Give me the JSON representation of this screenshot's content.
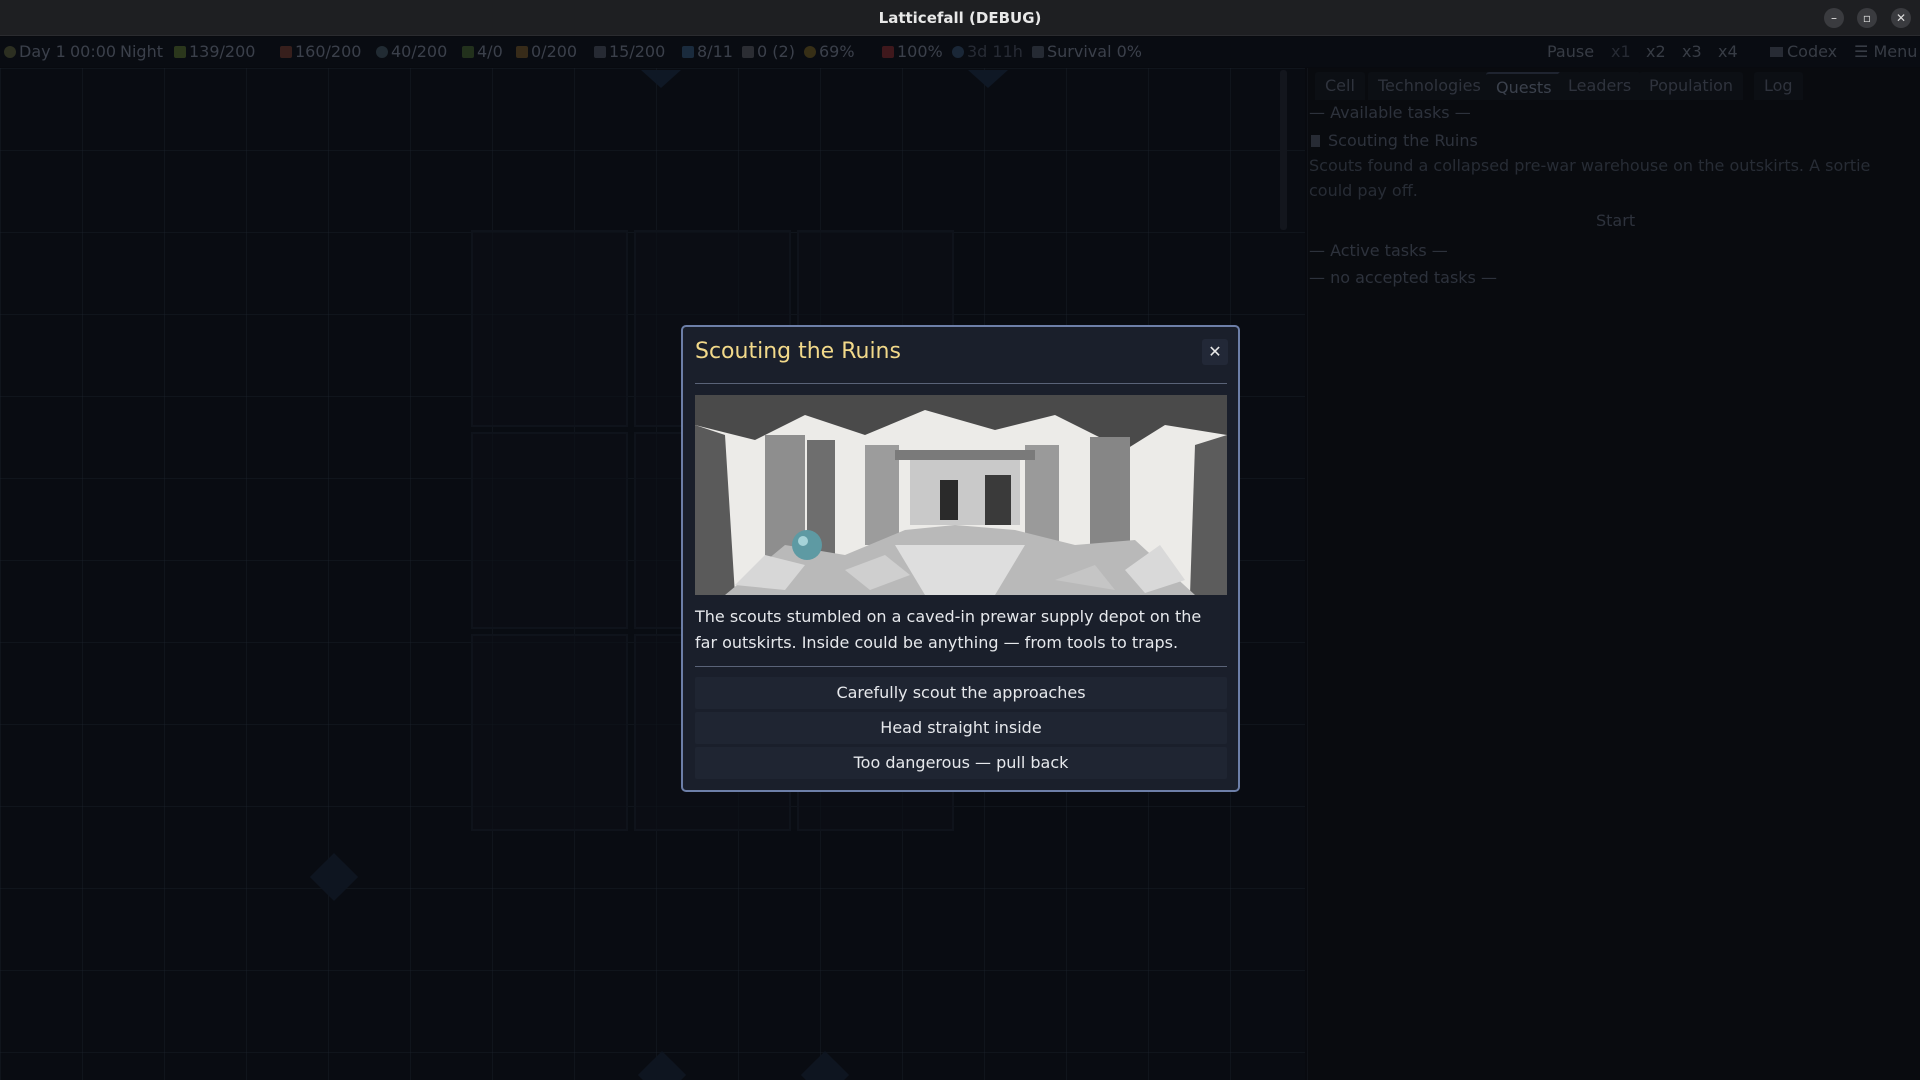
{
  "window": {
    "title": "Latticefall (DEBUG)",
    "min": "–",
    "max": "▫",
    "close": "✕"
  },
  "status": {
    "day": "Day 1",
    "time": "00:00",
    "phase": "Night",
    "food": "139/200",
    "materials": "160/200",
    "water": "40/200",
    "energy": "4/0",
    "medicine": "0/200",
    "ammo": "15/200",
    "population": "8/11",
    "builders": "0 (2)",
    "morale": "69%",
    "health": "100%",
    "timer": "3d 11h",
    "survival": "Survival 0%"
  },
  "controls": {
    "pause": "Pause",
    "x1": "x1",
    "x2": "x2",
    "x3": "x3",
    "x4": "x4",
    "codex": "Codex",
    "menu": "Menu"
  },
  "tabs": [
    "Cell",
    "Technologies",
    "Quests",
    "Leaders",
    "Population",
    "Log"
  ],
  "quests": {
    "available_header": "— Available tasks —",
    "quest_name": "Scouting the Ruins",
    "quest_desc": "Scouts found a collapsed pre-war warehouse on the outskirts. A sortie could pay off.",
    "start": "Start",
    "active_header": "— Active tasks —",
    "no_tasks": "— no accepted tasks —"
  },
  "modal": {
    "title": "Scouting the Ruins",
    "close": "✕",
    "description": "The scouts stumbled on a caved-in prewar supply depot on the far outskirts. Inside could be anything — from tools to traps.",
    "choices": [
      "Carefully scout the approaches",
      "Head straight inside",
      "Too dangerous — pull back"
    ]
  },
  "colors": {
    "accent": "#f2d98a",
    "modal_border": "#6d7fa8"
  }
}
